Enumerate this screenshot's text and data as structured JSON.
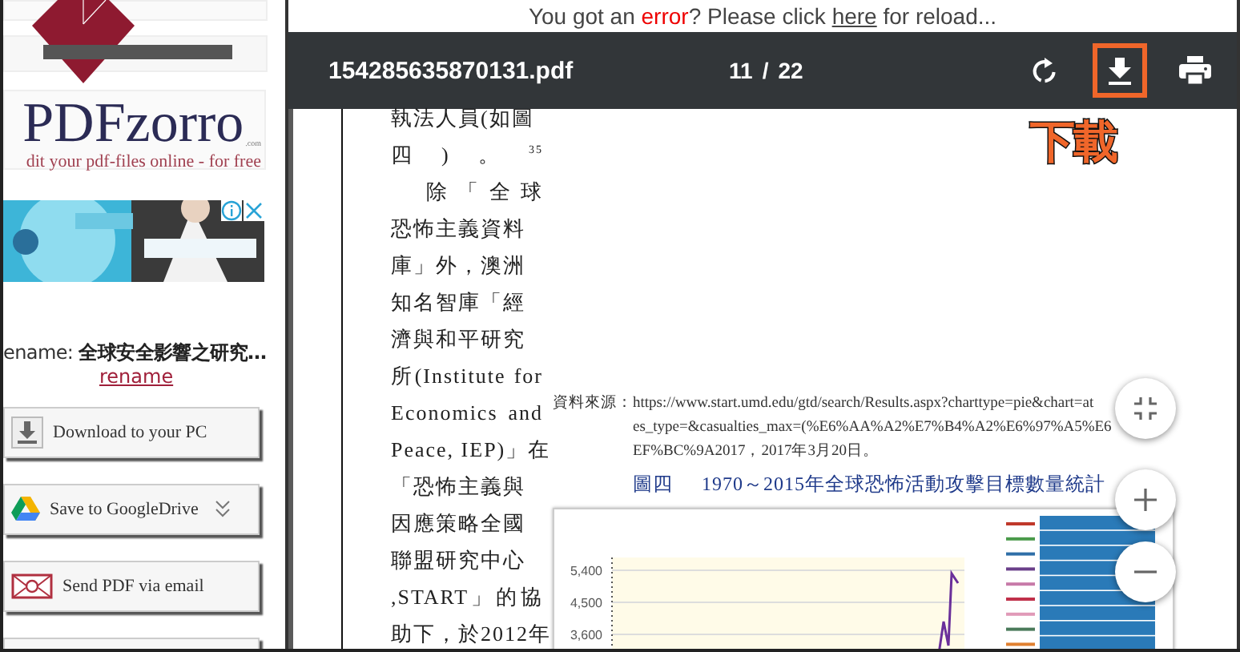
{
  "sidebar": {
    "logo": {
      "name": "PDFzorro",
      "domain": ".com",
      "tagline": "dit your pdf-files online - for free"
    },
    "file": {
      "label": "ename:",
      "value": "全球安全影響之研究…"
    },
    "rename_link": "rename",
    "buttons": [
      {
        "kind": "download",
        "label": "Download to your PC"
      },
      {
        "kind": "drive",
        "label": "Save to GoogleDrive"
      },
      {
        "kind": "email",
        "label": "Send PDF via email"
      },
      {
        "kind": "cut-off"
      }
    ]
  },
  "error_bar": {
    "before": "You got an ",
    "emphasis": "error",
    "middle": "? Please click ",
    "link": "here",
    "after": " for reload..."
  },
  "viewer": {
    "title": "154285635870131.pdf",
    "page": "11",
    "separator": "/",
    "total": "22",
    "actions": [
      {
        "kind": "rotate",
        "highlighted": false
      },
      {
        "kind": "download",
        "highlighted": true
      },
      {
        "kind": "print",
        "highlighted": false
      }
    ],
    "callout": "下載"
  },
  "document": {
    "column_lines": [
      "執法人員(如圖",
      "四)。$^{35}$",
      "除「全球",
      "恐怖主義資料",
      "庫」外，澳洲",
      "知名智庫「經",
      "濟與和平研究",
      "所(Institute for",
      "Economics and",
      "Peace, IEP)」在",
      "「恐怖主義與",
      "因應策略全國",
      "聯盟研究中心",
      ",START」的協",
      "助下，於2012年"
    ],
    "source": {
      "label": "資料來源：",
      "lines": [
        "https://www.start.umd.edu/gtd/search/Results.aspx?charttype=pie&chart=at",
        "es_type=&casualties_max=(%E6%AA%A2%E7%B4%A2%E6%97%A5%E6",
        "EF%BC%9A2017，2017年3月20日。"
      ]
    },
    "figure_caption": {
      "number": "圖四",
      "title": "1970～2015年全球恐怖活動攻擊目標數量統計"
    },
    "figure": {
      "yticks": [
        "5,400",
        "4,500",
        "3,600"
      ]
    }
  },
  "zoom_controls": [
    {
      "kind": "fit"
    },
    {
      "kind": "zoom-in"
    },
    {
      "kind": "zoom-out"
    }
  ]
}
